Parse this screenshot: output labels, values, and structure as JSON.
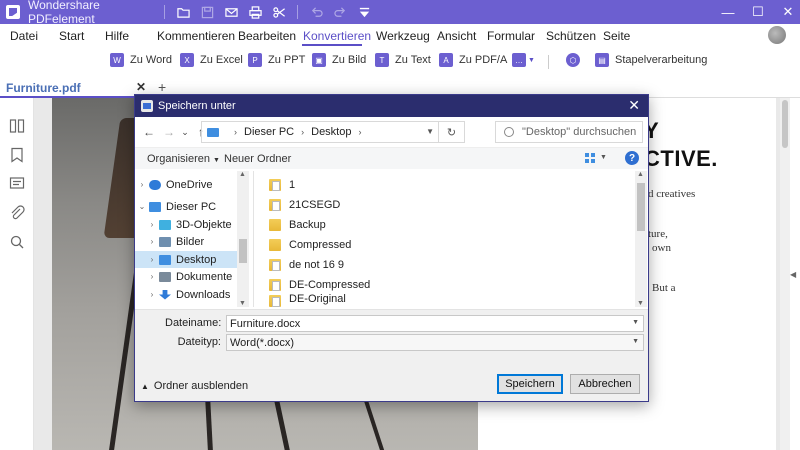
{
  "app": {
    "title": "Wondershare PDFelement",
    "brand_color": "#6c5fd0",
    "title_icons": [
      "folder-icon",
      "save-icon",
      "mail-icon",
      "print-icon",
      "scissors-icon",
      "undo-icon",
      "redo-icon",
      "quick-access-dropdown-icon"
    ]
  },
  "window_controls": {
    "minimize": "—",
    "maximize": "☐",
    "close": "✕"
  },
  "menu": {
    "items": [
      "Datei",
      "Start",
      "Hilfe",
      "Kommentieren",
      "Bearbeiten",
      "Konvertieren",
      "Werkzeug",
      "Ansicht",
      "Formular",
      "Schützen",
      "Seite"
    ],
    "active": "Konvertieren",
    "active_color": "#5b4fc7"
  },
  "toolbar": {
    "items": [
      {
        "label": "Zu Word",
        "icon": "W"
      },
      {
        "label": "Zu Excel",
        "icon": "X"
      },
      {
        "label": "Zu PPT",
        "icon": "P"
      },
      {
        "label": "Zu Bild",
        "icon": "▣"
      },
      {
        "label": "Zu Text",
        "icon": "T"
      },
      {
        "label": "Zu PDF/A",
        "icon": "A"
      },
      {
        "label": "",
        "icon": "…"
      },
      {
        "label": "",
        "icon": "⬡"
      },
      {
        "label": "Stapelverarbeitung",
        "icon": "▤"
      }
    ]
  },
  "tabs": {
    "document": "Furniture.pdf",
    "close": "✕",
    "add": "+"
  },
  "sidebar": {
    "icons": [
      "thumbnails-icon",
      "bookmark-icon",
      "comment-icon",
      "attachment-icon",
      "search-icon"
    ]
  },
  "document": {
    "partial_lines": [
      "Y",
      "CTIVE.",
      "d creatives",
      "ture,",
      "own",
      "But a"
    ]
  },
  "dialog": {
    "title": "Speichern unter",
    "close": "✕",
    "nav": {
      "back": "←",
      "forward": "→",
      "dropdown": "⌄",
      "up": "↑"
    },
    "path": [
      "Dieser PC",
      "Desktop"
    ],
    "search_placeholder": "\"Desktop\" durchsuchen",
    "commands": {
      "organize": "Organisieren",
      "new_folder": "Neuer Ordner",
      "help": "?"
    },
    "tree": [
      {
        "label": "OneDrive",
        "expanded": false,
        "level": 0,
        "icon_color": "#2f7bd8"
      },
      {
        "label": "Dieser PC",
        "expanded": true,
        "level": 0,
        "icon_color": "#3f8ee0"
      },
      {
        "label": "3D-Objekte",
        "expanded": false,
        "level": 1,
        "icon_color": "#3fb0e0"
      },
      {
        "label": "Bilder",
        "expanded": false,
        "level": 1,
        "icon_color": "#6f8faf"
      },
      {
        "label": "Desktop",
        "expanded": false,
        "level": 1,
        "icon_color": "#3f8ee0",
        "selected": true
      },
      {
        "label": "Dokumente",
        "expanded": false,
        "level": 1,
        "icon_color": "#7a8a9a"
      },
      {
        "label": "Downloads",
        "expanded": false,
        "level": 1,
        "icon_color": "#2f7bd8"
      }
    ],
    "files": [
      {
        "name": "1",
        "type": "folder-doc"
      },
      {
        "name": "21CSEGD",
        "type": "folder-doc"
      },
      {
        "name": "Backup",
        "type": "folder"
      },
      {
        "name": "Compressed",
        "type": "folder"
      },
      {
        "name": "de not 16 9",
        "type": "folder-doc"
      },
      {
        "name": "DE-Compressed",
        "type": "folder-doc"
      },
      {
        "name": "DE-Original",
        "type": "folder-doc"
      }
    ],
    "filename_label": "Dateiname:",
    "filename_value": "Furniture.docx",
    "filetype_label": "Dateityp:",
    "filetype_value": "Word(*.docx)",
    "hide_folders": "Ordner ausblenden",
    "save_button": "Speichern",
    "cancel_button": "Abbrechen",
    "title_color": "#2b2d6e",
    "selected_color": "#cce4f7"
  }
}
